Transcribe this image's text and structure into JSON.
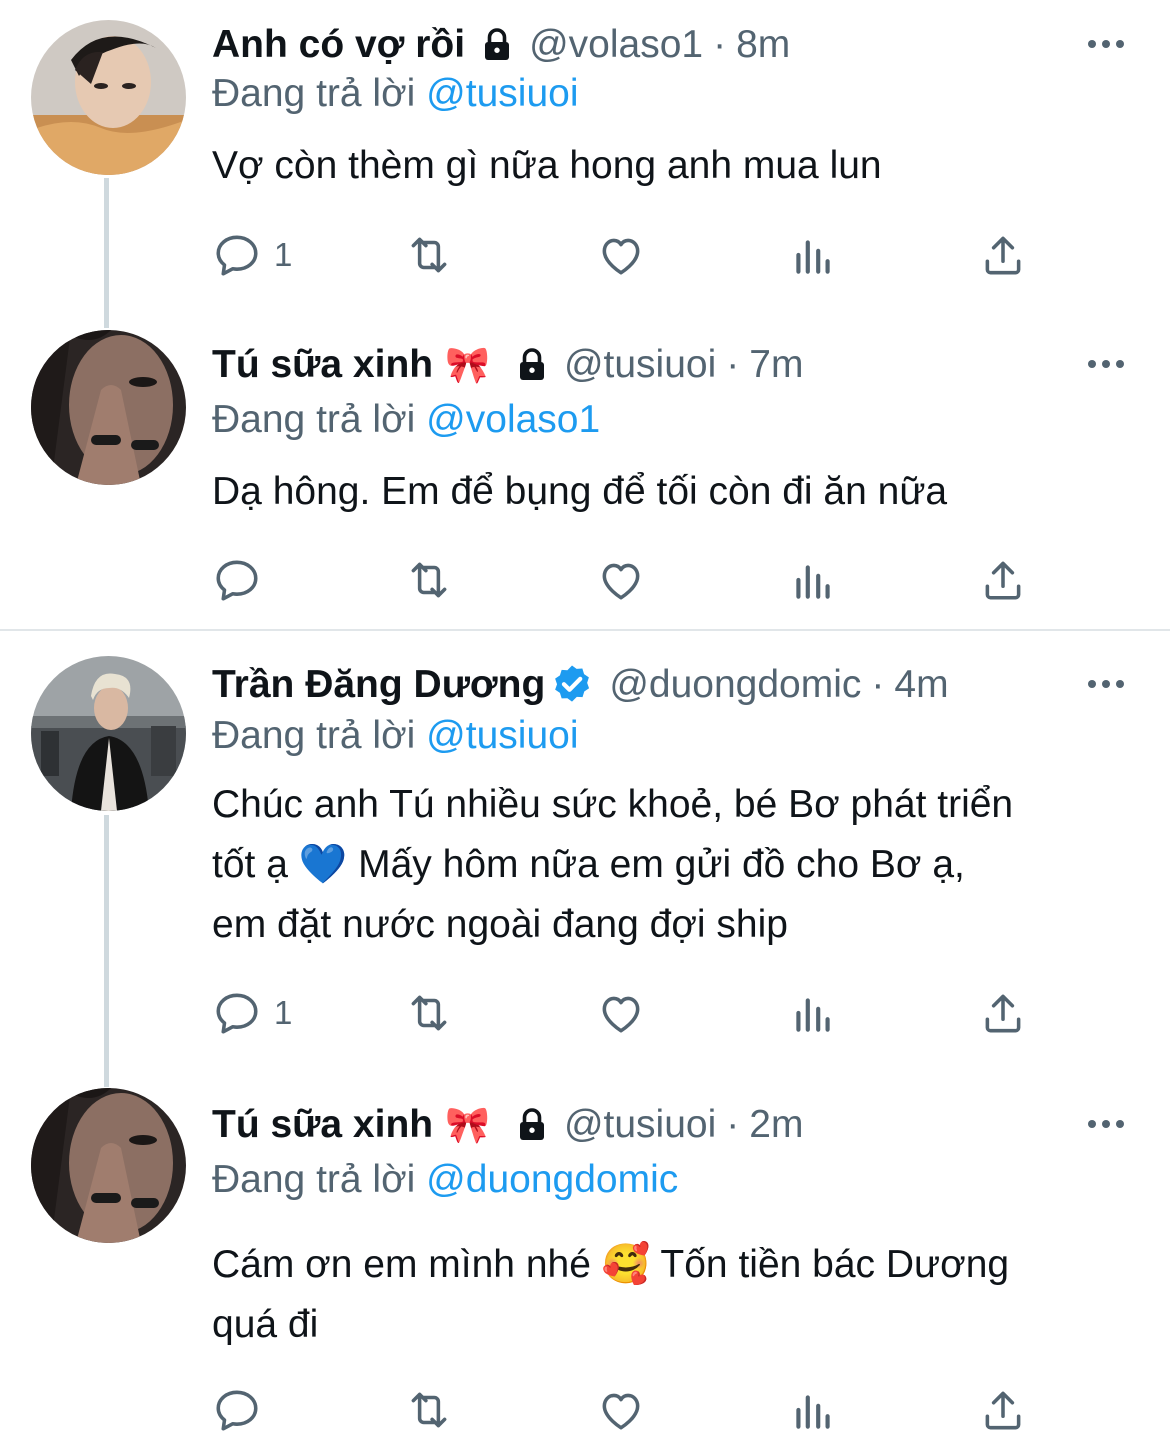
{
  "colors": {
    "text": "#0f1419",
    "secondary": "#536471",
    "link": "#1d9bf0",
    "verified": "#1d9bf0",
    "thread_line": "#cfd9de"
  },
  "tweets": [
    {
      "name": "Anh có vợ rồi",
      "name_emoji": "",
      "locked": true,
      "verified": false,
      "handle": "@volaso1",
      "separator": "·",
      "time": "8m",
      "reply_prefix": "Đang trả lời",
      "reply_to": "@tusiuoi",
      "text_lines": [
        "Vợ còn thèm gì nữa hong anh mua lun"
      ],
      "reply_count": "1"
    },
    {
      "name": "Tú sữa xinh",
      "name_emoji": "🎀",
      "locked": true,
      "verified": false,
      "handle": "@tusiuoi",
      "separator": "·",
      "time": "7m",
      "reply_prefix": "Đang trả lời",
      "reply_to": "@volaso1",
      "text_lines": [
        "Dạ hông. Em để bụng để tối còn đi ăn nữa"
      ],
      "reply_count": ""
    },
    {
      "name": "Trần Đăng Dương",
      "name_emoji": "",
      "locked": false,
      "verified": true,
      "handle": "@duongdomic",
      "separator": "·",
      "time": "4m",
      "reply_prefix": "Đang trả lời",
      "reply_to": "@tusiuoi",
      "text_lines": [
        "Chúc anh Tú nhiều sức khoẻ, bé Bơ phát triển",
        "tốt ạ 💙 Mấy hôm nữa em gửi đồ cho Bơ ạ,",
        "em đặt nước ngoài đang đợi ship"
      ],
      "reply_count": "1"
    },
    {
      "name": "Tú sữa xinh",
      "name_emoji": "🎀",
      "locked": true,
      "verified": false,
      "handle": "@tusiuoi",
      "separator": "·",
      "time": "2m",
      "reply_prefix": "Đang trả lời",
      "reply_to": "@duongdomic",
      "text_lines": [
        "Cám ơn em mình nhé 🥰 Tốn tiền bác Dương",
        "quá đi"
      ],
      "reply_count": ""
    }
  ],
  "action_icons": [
    "reply-icon",
    "retweet-icon",
    "like-icon",
    "views-icon",
    "share-icon"
  ]
}
